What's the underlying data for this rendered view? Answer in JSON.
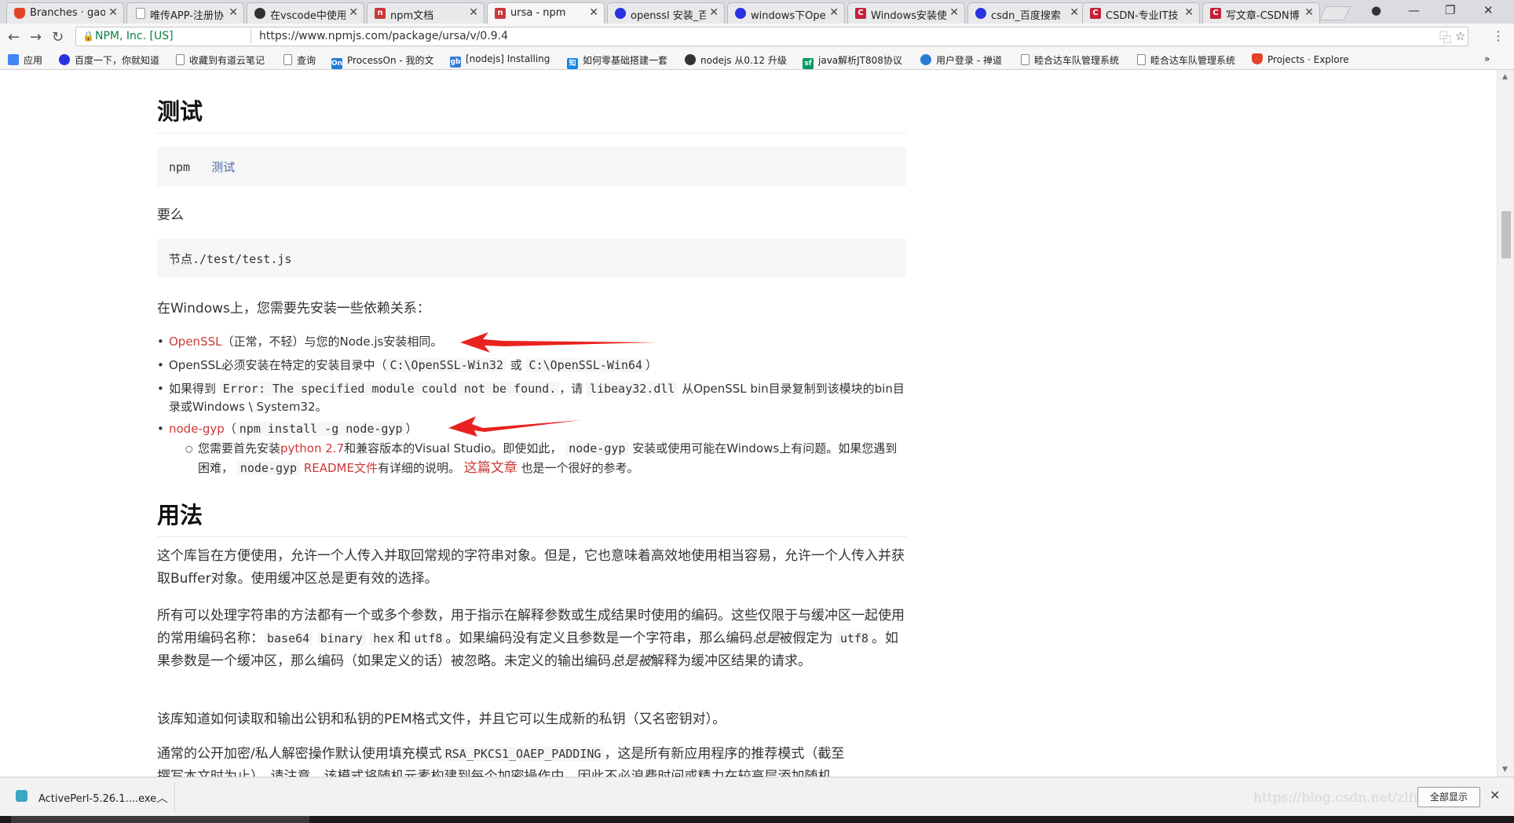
{
  "tabs": [
    {
      "title": "Branches · gaow",
      "favicon": "gitlab-icon",
      "color": "#e24329",
      "glyph": ""
    },
    {
      "title": "唯传APP-注册协",
      "favicon": "document-icon",
      "color": "#ffffff",
      "glyph": ""
    },
    {
      "title": "在vscode中使用",
      "favicon": "github-icon",
      "color": "#333333",
      "glyph": ""
    },
    {
      "title": "npm文档",
      "favicon": "npm-icon",
      "color": "#cb3837",
      "glyph": "n"
    },
    {
      "title": "ursa - npm",
      "favicon": "npm-icon",
      "color": "#cb3837",
      "glyph": "n"
    },
    {
      "title": "openssl 安装_百",
      "favicon": "baidu-icon",
      "color": "#2932e1",
      "glyph": ""
    },
    {
      "title": "windows下Oper",
      "favicon": "baidu-icon",
      "color": "#2932e1",
      "glyph": ""
    },
    {
      "title": "Windows安装使",
      "favicon": "csdn-icon",
      "color": "#c32136",
      "glyph": "C"
    },
    {
      "title": "csdn_百度搜索",
      "favicon": "baidu-icon",
      "color": "#2932e1",
      "glyph": ""
    },
    {
      "title": "CSDN-专业IT技",
      "favicon": "csdn-icon",
      "color": "#c32136",
      "glyph": "C"
    },
    {
      "title": "写文章-CSDN博",
      "favicon": "csdn-icon",
      "color": "#c32136",
      "glyph": "C"
    }
  ],
  "address": {
    "security_label": "NPM, Inc. [US]",
    "url": "https://www.npmjs.com/package/ursa/v/0.9.4"
  },
  "bookmarks": [
    {
      "label": "应用",
      "icon": "apps-icon",
      "color": "#4285f4"
    },
    {
      "label": "百度一下，你就知道",
      "icon": "baidu-icon",
      "color": "#2932e1"
    },
    {
      "label": "收藏到有道云笔记",
      "icon": "page-icon",
      "color": "#ffffff"
    },
    {
      "label": "查询",
      "icon": "page-icon",
      "color": "#ffffff"
    },
    {
      "label": "ProcessOn - 我的文",
      "icon": "processon-icon",
      "color": "#1e7bd6"
    },
    {
      "label": "[nodejs] Installing",
      "icon": "gb-icon",
      "color": "#3a7bd5"
    },
    {
      "label": "如何零基础搭建一套",
      "icon": "zhihu-icon",
      "color": "#0f88eb"
    },
    {
      "label": "nodejs 从0.12 升级",
      "icon": "cnblogs-icon",
      "color": "#333333"
    },
    {
      "label": "java解析JT808协议",
      "icon": "segmentfault-icon",
      "color": "#009a61"
    },
    {
      "label": "用户登录 - 禅道",
      "icon": "globe-icon",
      "color": "#2a7ad2"
    },
    {
      "label": "睦合达车队管理系统",
      "icon": "page-icon",
      "color": "#ffffff"
    },
    {
      "label": "睦合达车队管理系统",
      "icon": "page-icon",
      "color": "#ffffff"
    },
    {
      "label": "Projects · Explore",
      "icon": "gitlab-icon",
      "color": "#e24329"
    }
  ],
  "content": {
    "h_test": "测试",
    "code_test_cmd": "npm",
    "code_test_arg": "测试",
    "p_or": "要么",
    "code_node": "节点./test/test.js",
    "p_windows": "在Windows上，您需要先安装一些依赖关系：",
    "li1_link": "OpenSSL",
    "li1_text": "（正常，不轻）与您的Node.js安装相同。",
    "li2_a": "OpenSSL必须安装在特定的安装目录中（",
    "li2_code1": "C:\\OpenSSL-Win32",
    "li2_b": "或",
    "li2_code2": "C:\\OpenSSL-Win64",
    "li2_c": "）",
    "li3_a": "如果得到",
    "li3_code1": "Error: The specified module could not be found.",
    "li3_b": "，请",
    "li3_code2": "libeay32.dll",
    "li3_c": "从OpenSSL bin目录复制到该模块的bin目录或Windows \\ System32。",
    "li4_link": "node-gyp",
    "li4_a": "（",
    "li4_code": "npm install -g node-gyp",
    "li4_b": "）",
    "sub_a": "您需要首先安装",
    "sub_link1": "python 2.7",
    "sub_b": "和兼容版本的Visual Studio。即使如此，",
    "sub_code1": "node-gyp",
    "sub_c": "安装或使用可能在Windows上有问题。如果您遇到困难，",
    "sub_code2": "node-gyp",
    "sub_link2": "README文件",
    "sub_d": "有详细的说明。",
    "sub_link3": "这篇文章",
    "sub_e": "也是一个很好的参考。",
    "h_usage": "用法",
    "p1": "这个库旨在方便使用，允许一个人传入并取回常规的字符串对象。但是，它也意味着高效地使用相当容易，允许一个人传入并获取Buffer对象。使用缓冲区总是更有效的选择。",
    "p2_a": "所有可以处理字符串的方法都有一个或多个参数，用于指示在解释参数或生成结果时使用的编码。这些仅限于与缓冲区一起使用的常用编码名称：",
    "p2_c1": "base64",
    "p2_c2": "binary",
    "p2_c3": "hex",
    "p2_b": "和",
    "p2_c4": "utf8",
    "p2_c": "。如果编码没有定义且参数是一个字符串，那么编码",
    "p2_em1": "总是",
    "p2_d": "被假定为",
    "p2_c5": "utf8",
    "p2_e": "。如果参数是一个缓冲区，那么编码（如果定义的话）被忽略。未定义的输出编码",
    "p2_em2": "总是被",
    "p2_f": "解释为缓冲区结果的请求。",
    "p3": "该库知道如何读取和输出公钥和私钥的PEM格式文件，并且它可以生成新的私钥（又名密钥对）。",
    "p4_a": "通常的公开加密/私人解密操作默认使用填充模式",
    "p4_code": "RSA_PKCS1_OAEP_PADDING",
    "p4_b": "，这是所有新应用程序的推荐模式（截至",
    "p4_line2": "撰写本文时为止）。请注意，该模式将随机元素构建到每个加密操作中，因此不必浪费时间或精力在较高层添加随机"
  },
  "download": {
    "filename": "ActivePerl-5.26.1....exe",
    "show_all": "全部显示",
    "watermark": "https://blog.csdn.net/zlfm_jun"
  },
  "colors": {
    "link": "#cb3837",
    "arrow": "#e8231f"
  }
}
